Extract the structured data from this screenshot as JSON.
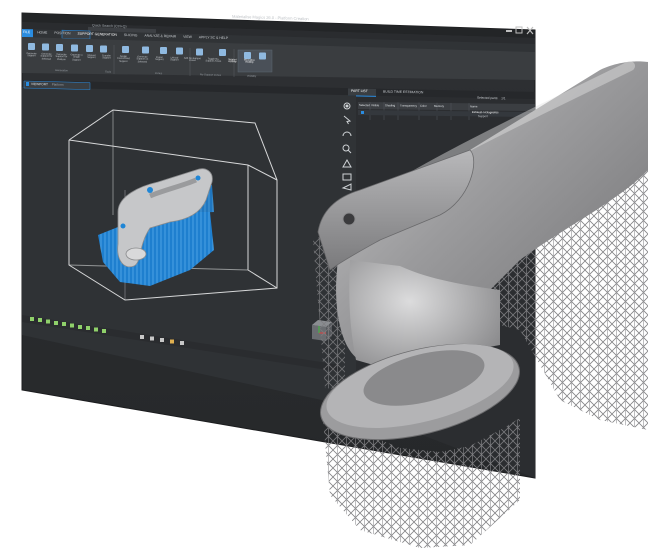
{
  "window": {
    "title": "Materialise Magics 26.0 - Platform Creation",
    "quick_search": "Quick Search (Ctrl+Q)"
  },
  "ribbon": {
    "tabs": [
      "FILE",
      "HOME",
      "POSITION",
      "SUPPORT GENERATION",
      "SLICING",
      "ANALYZE & REPAIR",
      "VIEW",
      "APPLY SC & HELP"
    ],
    "active_tab_index": 3,
    "buttons": [
      "Generate Support",
      "Generate Support for Selected",
      "Generate Support for Platform",
      "Generate a Single Support",
      "Manual Support",
      "Transfer Support",
      "Assign Customized Support",
      "Generate Support on Selected",
      "Export Support",
      "Unload Support",
      "Add No-Support Zones",
      "Toggle No-Support Zones",
      "Support Visibility",
      "Microslice Visibility"
    ],
    "groups": [
      "Generation",
      "Tools",
      "Zones",
      "No-Support Zones",
      "Visibility"
    ]
  },
  "viewport": {
    "tab_label": "VIEWPORT",
    "tab_extra": "Platform"
  },
  "panel": {
    "tabs": [
      "PART LIST",
      "BUILD TIME ESTIMATION"
    ],
    "selected_parts_label": "Selected parts:",
    "selected_parts_value": "1/1",
    "columns": [
      "Selected",
      "Visible",
      "Shading",
      "Transparency",
      "Color",
      "Memory",
      "Name"
    ],
    "rows": [
      {
        "name": "Exhaust-n-Diagnotics",
        "indent": 0
      },
      {
        "name": "Support",
        "indent": 1
      }
    ]
  },
  "colors": {
    "app_bg": "#2f3133",
    "ribbon_bg": "#3a3d40",
    "accent": "#2a8ce0",
    "support_blue": "#1f86d6",
    "metal": "#9a9a9c"
  },
  "icons": [
    "gear-icon",
    "cursor-icon",
    "rotate-icon",
    "zoom-icon",
    "triangle-icon",
    "section-icon",
    "measure-icon"
  ]
}
